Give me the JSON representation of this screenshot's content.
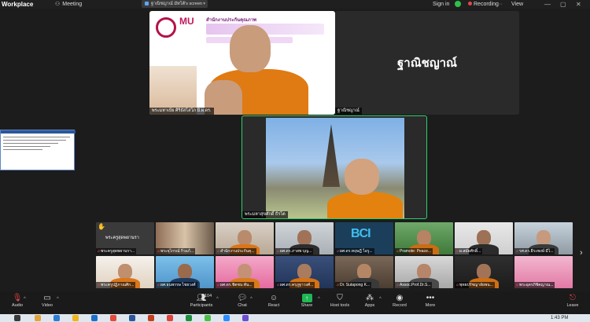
{
  "topbar": {
    "app_name": "Workplace",
    "meeting_label": "Meeting",
    "share_indicator": "ฐาณิชญาณ์ มัทโต้'s screen",
    "sign_in": "Sign in",
    "recording": "Recording",
    "more": "···",
    "view": "View"
  },
  "main": {
    "share_tile_label": "พระมหาเป้ย ศิริธัสโสโภ มิ.ผ.ดร.",
    "share_slide_title": "สำนักงานประกันคุณภาพ",
    "share_logo_text": "MU",
    "name_tile_name": "ฐาณิชญาณ์",
    "name_tile_label": "ฐาณิชญาณ์",
    "speaker_label": "พระมหาสุขศักดิ์ ธีรโต"
  },
  "gallery": [
    {
      "label": "พระครูสุดพยานรา...",
      "label2": "พระครูสุดพยานรา"
    },
    {
      "label": "พระจุไกรณ์ กิ่วแก้..."
    },
    {
      "label": "สำนักงานประกันคุ..."
    },
    {
      "label": "ผศ.ดร.ภาสพ บุญ..."
    },
    {
      "label": "ผศ.ดร.ทฤษฎี ไอรู..."
    },
    {
      "label": "Pramote: Peace..."
    },
    {
      "label": "ผ.สมัยศักดิ์..."
    },
    {
      "label": "รศ.ดร.ธีระพงษ์ มีไ..."
    },
    {
      "label": "พระครูปฏิภาณศิก..."
    },
    {
      "label": "ผศ.ธนพรรษ ไชยวงศ์"
    },
    {
      "label": "ผศ.ดร.ชิตชน พัน..."
    },
    {
      "label": "ผศ.ดร.ครุภูฐาวงศ์..."
    },
    {
      "label": "Dr. Sutapong K..."
    },
    {
      "label": "Assoc.Prof.Dr.S..."
    },
    {
      "label": "พุทธปรัชญาลัยพน..."
    },
    {
      "label": "พระอุดรภิชิตญาณ..."
    }
  ],
  "bci_text": "BCI",
  "controls": {
    "audio": "Audio",
    "video": "Video",
    "participants": "Participants",
    "participants_count": "104",
    "chat": "Chat",
    "react": "React",
    "share": "Share",
    "host_tools": "Host tools",
    "apps": "Apps",
    "record": "Record",
    "more": "More",
    "leave": "Leave"
  },
  "taskbar": {
    "time": "1:43 PM"
  },
  "colors": {
    "active_speaker_border": "#2ecf6b",
    "share_button": "#1fb854",
    "leave": "#e34848",
    "robe": "#e07a12"
  }
}
